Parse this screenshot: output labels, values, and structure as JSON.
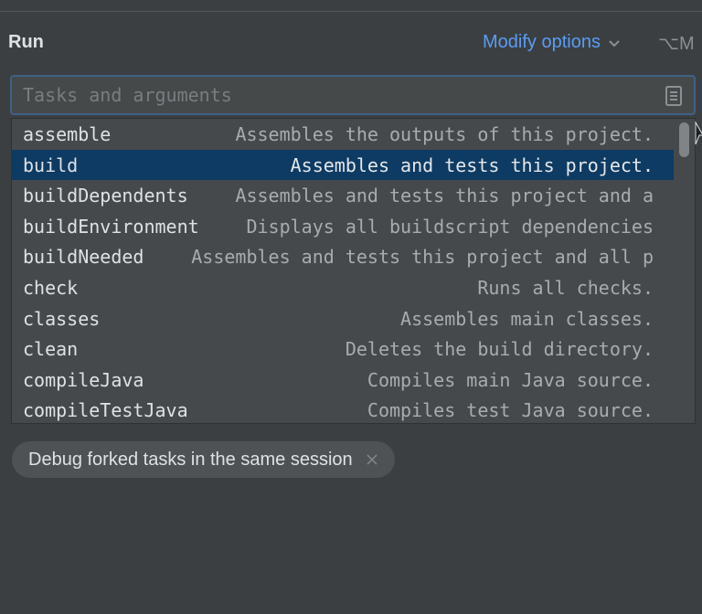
{
  "section": {
    "title": "Run"
  },
  "modify_options": {
    "label": "Modify options",
    "shortcut": "⌥M",
    "icon": "chevron-down-icon"
  },
  "tasks_field": {
    "placeholder": "Tasks and arguments",
    "value": "",
    "icon": "document-icon"
  },
  "task_list": {
    "selected_index": 1,
    "items": [
      {
        "name": "assemble",
        "description": "Assembles the outputs of this project."
      },
      {
        "name": "build",
        "description": "Assembles and tests this project."
      },
      {
        "name": "buildDependents",
        "description": "Assembles and tests this project and a"
      },
      {
        "name": "buildEnvironment",
        "description": "Displays all buildscript dependencies"
      },
      {
        "name": "buildNeeded",
        "description": "Assembles and tests this project and all p"
      },
      {
        "name": "check",
        "description": "Runs all checks."
      },
      {
        "name": "classes",
        "description": "Assembles main classes."
      },
      {
        "name": "clean",
        "description": "Deletes the build directory."
      },
      {
        "name": "compileJava",
        "description": "Compiles main Java source."
      },
      {
        "name": "compileTestJava",
        "description": "Compiles test Java source."
      }
    ]
  },
  "option_chip": {
    "label": "Debug forked tasks in the same session",
    "icon": "close-icon"
  },
  "colors": {
    "background": "#3c3f41",
    "accent": "#589df6",
    "selection": "#0d3b63",
    "focus_border": "#3d6185"
  }
}
